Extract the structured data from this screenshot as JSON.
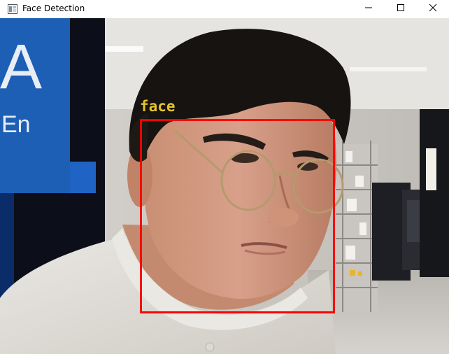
{
  "window": {
    "title": "Face Detection",
    "icon": "app-window-icon",
    "controls": {
      "minimize": "minimize-icon",
      "maximize": "maximize-icon",
      "close": "close-icon"
    }
  },
  "detection": {
    "label": "face",
    "box_color": "#ff0000",
    "label_color": "#e5c230"
  },
  "background_sign": {
    "letters": "A",
    "small_text": "En"
  }
}
